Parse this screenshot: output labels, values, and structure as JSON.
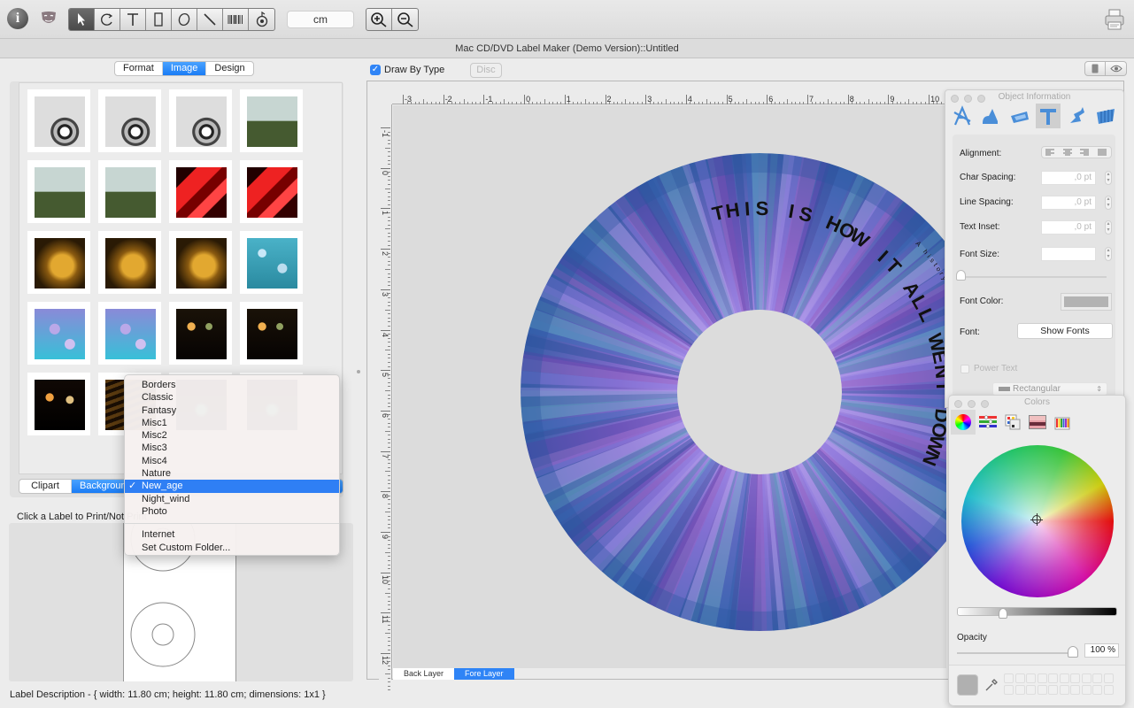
{
  "toolbar": {
    "info_icon": "info-icon",
    "mask_icon": "theater-mask-icon",
    "tools": [
      {
        "name": "select-tool",
        "icon": "arrow-pointer-icon",
        "active": true
      },
      {
        "name": "rotate-tool",
        "icon": "rotate-icon",
        "active": false
      },
      {
        "name": "text-tool",
        "icon": "text-t-icon",
        "active": false
      },
      {
        "name": "rectangle-tool",
        "icon": "rectangle-icon",
        "active": false
      },
      {
        "name": "ellipse-tool",
        "icon": "ellipse-icon",
        "active": false
      },
      {
        "name": "line-tool",
        "icon": "line-icon",
        "active": false
      },
      {
        "name": "barcode-tool",
        "icon": "barcode-icon",
        "active": false
      },
      {
        "name": "image-tool",
        "icon": "image-stamp-icon",
        "active": false
      }
    ],
    "unit": "cm",
    "zoom_in_icon": "zoom-in-icon",
    "zoom_out_icon": "zoom-out-icon",
    "print_icon": "printer-icon"
  },
  "window": {
    "title": "Mac CD/DVD Label Maker (Demo Version)::Untitled"
  },
  "left_panel": {
    "tabs": [
      {
        "label": "Format",
        "selected": false
      },
      {
        "label": "Image",
        "selected": true
      },
      {
        "label": "Design",
        "selected": false
      }
    ],
    "thumbnails": [
      "abstract-circles-1",
      "abstract-circles-2",
      "abstract-circles-3",
      "green-field-1",
      "green-field-2",
      "green-field-3",
      "red-shards-1",
      "red-shards-2",
      "golden-statue-1",
      "golden-statue-2",
      "golden-statue-3",
      "blue-bokeh-1",
      "purple-bokeh-1",
      "purple-bokeh-2",
      "night-bokeh-1",
      "night-bokeh-2",
      "night-lights-1",
      "night-stairs-1",
      "night-city-1",
      "night-city-2"
    ],
    "source_tabs": [
      {
        "label": "Clipart",
        "selected": false
      },
      {
        "label": "Background",
        "selected": true
      }
    ],
    "category_menu": {
      "items": [
        "Borders",
        "Classic",
        "Fantasy",
        "Misc1",
        "Misc2",
        "Misc3",
        "Misc4",
        "Nature",
        "New_age",
        "Night_wind",
        "Photo"
      ],
      "selected": "New_age",
      "extra_items": [
        "Internet",
        "Set Custom Folder..."
      ]
    },
    "print_note": "Click a Label to Print/Not Print",
    "label_description": "Label Description - { width: 11.80 cm; height: 11.80 cm; dimensions: 1x1 }"
  },
  "canvas": {
    "draw_by_type_label": "Draw By Type",
    "draw_by_type_checked": true,
    "disc_button": "Disc",
    "hruler_labels": [
      "-3",
      "-2",
      "-1",
      "0",
      "1",
      "2",
      "3",
      "4",
      "5",
      "6",
      "7",
      "8",
      "9",
      "10"
    ],
    "vruler_labels": [
      "-1",
      "0",
      "1",
      "2",
      "3",
      "4",
      "5",
      "6",
      "7",
      "8",
      "9",
      "10",
      "11",
      "12"
    ],
    "disc_title": "THIS IS HOW IT ALL WENT DOWN",
    "disc_subtitle": "A history of what my failures taught me",
    "layers": [
      {
        "label": "Back Layer",
        "selected": false
      },
      {
        "label": "Fore Layer",
        "selected": true
      }
    ]
  },
  "object_info": {
    "title": "Object Information",
    "icons": [
      "geometry-tool-icon",
      "shapes-icon",
      "frame-icon",
      "text-tool-icon",
      "effects-icon",
      "layers-icon"
    ],
    "selected_icon": "text-tool-icon",
    "alignment_label": "Alignment:",
    "char_spacing_label": "Char Spacing:",
    "char_spacing_value": ",0 pt",
    "line_spacing_label": "Line Spacing:",
    "line_spacing_value": ",0 pt",
    "text_inset_label": "Text Inset:",
    "text_inset_value": ",0 pt",
    "font_size_label": "Font Size:",
    "font_size_value": "",
    "font_color_label": "Font Color:",
    "font_label": "Font:",
    "show_fonts_button": "Show Fonts",
    "power_text_label": "Power Text",
    "shape_select": "Rectangular"
  },
  "colors_panel": {
    "title": "Colors",
    "modes": [
      "color-wheel-icon",
      "color-sliders-icon",
      "color-palettes-icon",
      "image-palettes-icon",
      "crayons-icon"
    ],
    "selected_mode": "color-wheel-icon",
    "opacity_label": "Opacity",
    "opacity_value": "100 %",
    "opacity_fraction": 1.0,
    "brightness_fraction": 0.28,
    "current_color": "#b0b0b0"
  },
  "colors": {
    "accent": "#2f7ff4",
    "selected_tool_bg": "#4a4a4a"
  }
}
